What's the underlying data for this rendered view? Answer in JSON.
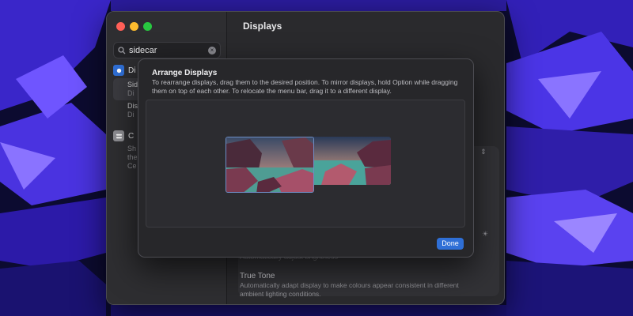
{
  "window": {
    "title": "Displays",
    "search_value": "sidecar"
  },
  "sidebar": {
    "items": [
      {
        "label": "Di",
        "icon": "displays-icon"
      },
      {
        "label": "C",
        "icon": "control-centre-icon"
      }
    ],
    "subitems": [
      {
        "title": "Sid",
        "desc": "Di"
      },
      {
        "title": "Dis",
        "desc": "Di"
      }
    ],
    "desc_lines": [
      "Sh",
      "the",
      "Ce"
    ]
  },
  "content": {
    "faint_label": "Automatically adjust brightness",
    "true_tone_title": "True Tone",
    "true_tone_desc": "Automatically adapt display to make colours appear consistent in different ambient lighting conditions."
  },
  "sheet": {
    "title": "Arrange Displays",
    "description": "To rearrange displays, drag them to the desired position. To mirror displays, hold Option while dragging them on top of each other. To relocate the menu bar, drag it to a different display.",
    "done_label": "Done"
  },
  "colors": {
    "accent": "#2f6fd6",
    "window_bg": "#2a2a2d",
    "sheet_bg": "#27272a"
  }
}
